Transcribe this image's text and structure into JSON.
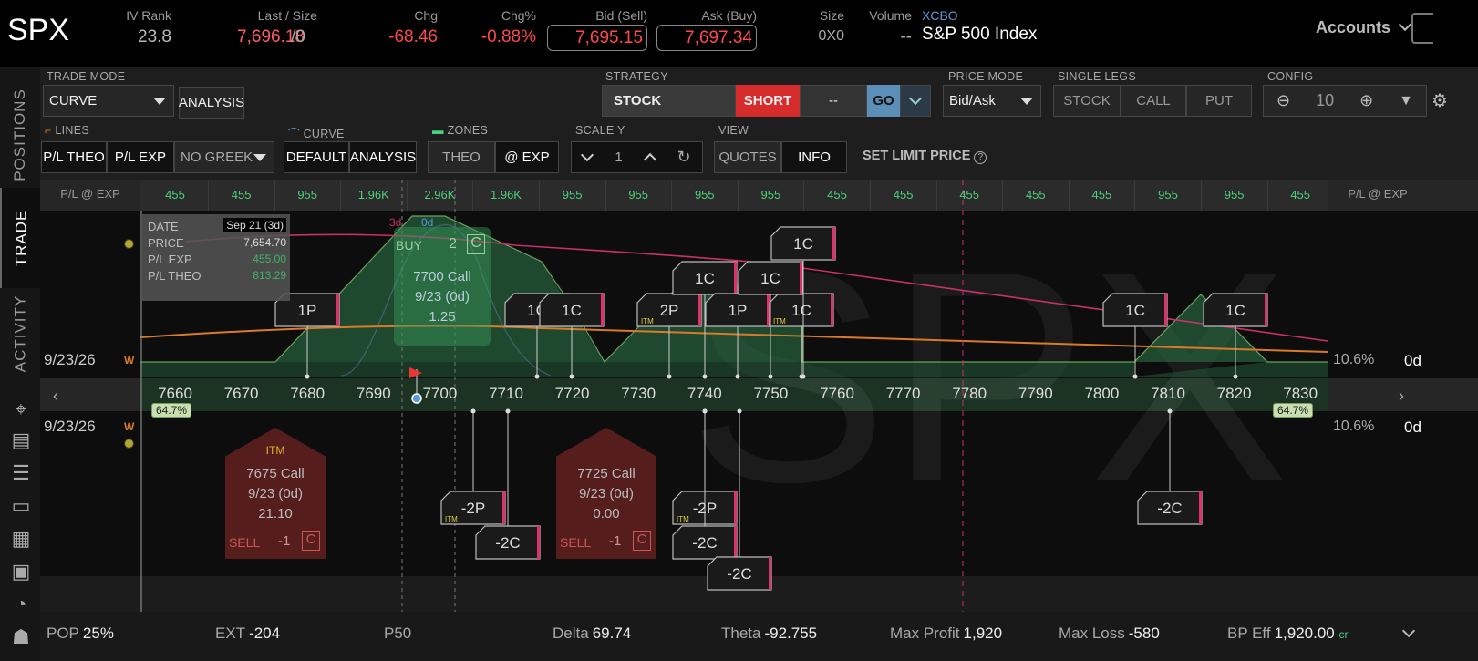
{
  "quote": {
    "symbol": "SPX",
    "iv_rank_label": "IV Rank",
    "iv_rank": "23.8",
    "last_label": "Last / Size",
    "last": "7,696.18",
    "last_size": "/0",
    "chg_label": "Chg",
    "chg": "-68.46",
    "chgpct_label": "Chg%",
    "chgpct": "-0.88%",
    "bid_label": "Bid (Sell)",
    "bid": "7,695.15",
    "ask_label": "Ask (Buy)",
    "ask": "7,697.34",
    "size_label": "Size",
    "size": "0X0",
    "volume_label": "Volume",
    "volume": "--",
    "exchange": "XCBO",
    "description": "S&P 500 Index",
    "accounts": "Accounts"
  },
  "nav": {
    "positions": "POSITIONS",
    "trade": "TRADE",
    "activity": "ACTIVITY"
  },
  "toolbar": {
    "trade_mode_label": "TRADE MODE",
    "trade_mode": "CURVE",
    "analysis": "ANALYSIS",
    "strategy_label": "STRATEGY",
    "strategy": "STOCK",
    "side": "SHORT",
    "qty": "--",
    "go": "GO",
    "price_mode_label": "PRICE MODE",
    "price_mode": "Bid/Ask",
    "single_legs_label": "SINGLE LEGS",
    "leg_stock": "STOCK",
    "leg_call": "CALL",
    "leg_put": "PUT",
    "config_label": "CONFIG",
    "zoom": "10",
    "lines_label": "LINES",
    "pl_theo": "P/L THEO",
    "pl_exp": "P/L EXP",
    "greek": "NO GREEK",
    "curve_label": "CURVE",
    "curve_default": "DEFAULT",
    "curve_analysis": "ANALYSIS",
    "zones_label": "ZONES",
    "zone_theo": "THEO",
    "zone_exp": "@ EXP",
    "scale_label": "SCALE Y",
    "scale": "1",
    "view_label": "VIEW",
    "view_quotes": "QUOTES",
    "view_info": "INFO",
    "set_limit": "SET LIMIT PRICE"
  },
  "chart": {
    "pl_header_left": "P/L @ EXP",
    "pl_header_right": "P/L @ EXP",
    "pl_values": [
      "455",
      "455",
      "955",
      "1.96K",
      "2.96K",
      "1.96K",
      "955",
      "955",
      "955",
      "955",
      "455",
      "455",
      "455",
      "455",
      "455",
      "955",
      "955",
      "455"
    ],
    "strikes": [
      "7660",
      "7670",
      "7680",
      "7690",
      "7700",
      "7710",
      "7720",
      "7730",
      "7740",
      "7750",
      "7760",
      "7770",
      "7780",
      "7790",
      "7800",
      "7810",
      "7820",
      "7830"
    ],
    "expiry_top": "9/23/26",
    "expiry_bottom": "9/23/26",
    "w": "W",
    "iv_right_top": "10.6%",
    "dte_right_top": "0d",
    "iv_right_bottom": "10.6%",
    "dte_right_bottom": "0d",
    "prob_left": "64.7%",
    "prob_right": "64.7%",
    "curve_label_3d": "3d",
    "curve_label_0d": "0d",
    "watermark": "SPX"
  },
  "tooltip": {
    "date_label": "DATE",
    "date": "Sep 21 (3d)",
    "price_label": "PRICE",
    "price": "7,654.70",
    "plexp_label": "P/L EXP",
    "plexp": "455.00",
    "pltheo_label": "P/L THEO",
    "pltheo": "813.29"
  },
  "buy_card": {
    "action": "BUY",
    "qty": "2",
    "type": "C",
    "line1": "7700 Call",
    "line2": "9/23 (0d)",
    "line3": "1.25"
  },
  "sell_cards": [
    {
      "itm": "ITM",
      "line1": "7675 Call",
      "line2": "9/23 (0d)",
      "line3": "21.10",
      "action": "SELL",
      "qty": "-1",
      "type": "C"
    },
    {
      "itm": "",
      "line1": "7725 Call",
      "line2": "9/23 (0d)",
      "line3": "0.00",
      "action": "SELL",
      "qty": "-1",
      "type": "C"
    }
  ],
  "legs_top": [
    "1P",
    "1C",
    "1C",
    "2P",
    "1C",
    "1P",
    "1C",
    "1C",
    "1C",
    "1C",
    "1C"
  ],
  "legs_bottom": [
    "-2P",
    "-2C",
    "-2P",
    "-2C",
    "-2C",
    "-2C"
  ],
  "itm_tag": "ITM",
  "status": {
    "pop_label": "POP",
    "pop": "25%",
    "ext_label": "EXT",
    "ext": "-204",
    "p50_label": "P50",
    "delta_label": "Delta",
    "delta": "69.74",
    "theta_label": "Theta",
    "theta": "-92.755",
    "maxprofit_label": "Max Profit",
    "maxprofit": "1,920",
    "maxloss_label": "Max Loss",
    "maxloss": "-580",
    "bpeff_label": "BP Eff",
    "bpeff": "1,920.00",
    "bpeff_unit": "cr"
  },
  "colors": {
    "profit_fill": "#2d6b44",
    "red": "#ff4a4a",
    "green": "#4bd07a",
    "accent_pink": "#e0306a",
    "orange": "#d87a2a"
  }
}
